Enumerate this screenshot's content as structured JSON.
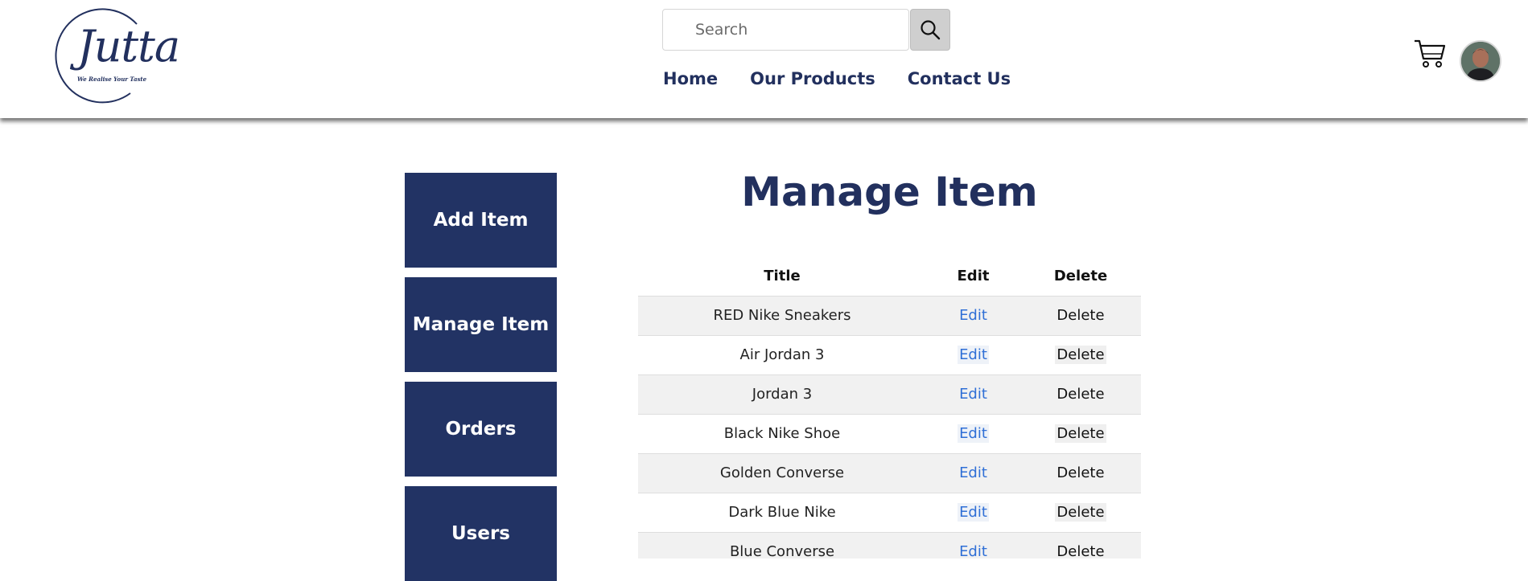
{
  "header": {
    "logo_text": "Jutta",
    "logo_tagline": "We Realise Your Taste",
    "search": {
      "placeholder": "Search",
      "value": ""
    },
    "nav": [
      {
        "label": "Home"
      },
      {
        "label": "Our Products"
      },
      {
        "label": "Contact Us"
      }
    ],
    "icons": {
      "search": "search-icon",
      "cart": "cart-icon",
      "avatar": "user-avatar"
    }
  },
  "sidebar": {
    "items": [
      {
        "label": "Add Item"
      },
      {
        "label": "Manage Item"
      },
      {
        "label": "Orders"
      },
      {
        "label": "Users"
      }
    ]
  },
  "main": {
    "title": "Manage Item",
    "table": {
      "headers": [
        "Title",
        "Edit",
        "Delete"
      ],
      "rows": [
        {
          "title": "RED Nike Sneakers",
          "edit": "Edit",
          "delete": "Delete"
        },
        {
          "title": "Air Jordan 3",
          "edit": "Edit",
          "delete": "Delete"
        },
        {
          "title": "Jordan 3",
          "edit": "Edit",
          "delete": "Delete"
        },
        {
          "title": "Black Nike Shoe",
          "edit": "Edit",
          "delete": "Delete"
        },
        {
          "title": "Golden Converse",
          "edit": "Edit",
          "delete": "Delete"
        },
        {
          "title": "Dark Blue Nike",
          "edit": "Edit",
          "delete": "Delete"
        },
        {
          "title": "Blue Converse",
          "edit": "Edit",
          "delete": "Delete"
        }
      ]
    }
  },
  "colors": {
    "brand": "#22305e",
    "sidebar_bg": "#223364",
    "link": "#2f6fd6",
    "row_stripe": "#f1f1f1"
  }
}
